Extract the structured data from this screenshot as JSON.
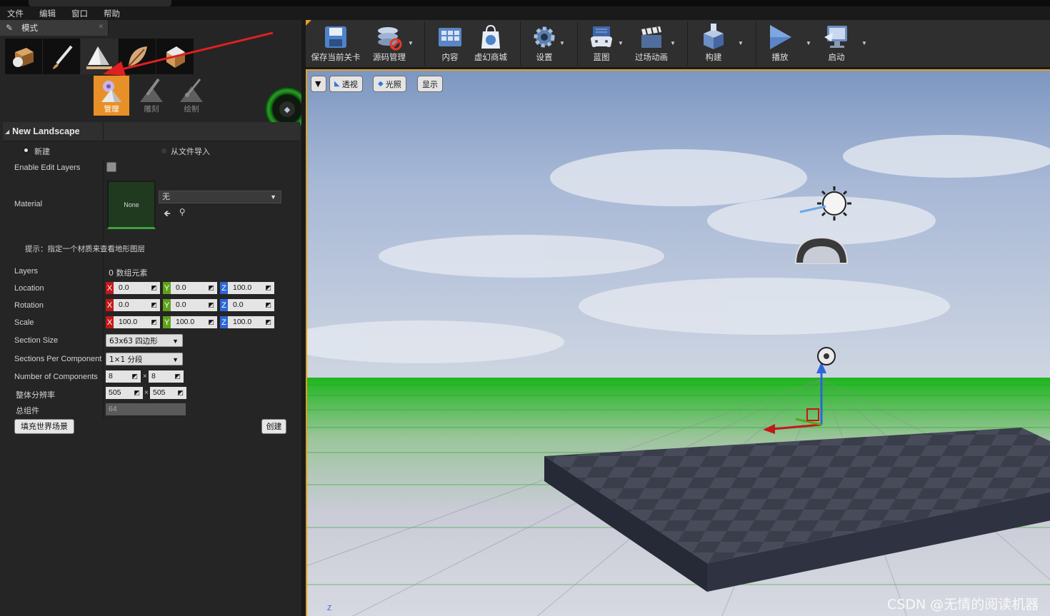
{
  "menubar": {
    "items": [
      "文件",
      "编辑",
      "窗口",
      "帮助"
    ]
  },
  "modes_tab": {
    "label": "模式",
    "icon": "modes-icon"
  },
  "mode_buttons": [
    {
      "name": "place-mode-icon"
    },
    {
      "name": "paint-mode-icon"
    },
    {
      "name": "landscape-mode-icon",
      "active": true
    },
    {
      "name": "foliage-mode-icon"
    },
    {
      "name": "geometry-mode-icon"
    }
  ],
  "landscape_tools": [
    {
      "label": "管理",
      "icon": "manage-icon",
      "active": true
    },
    {
      "label": "雕刻",
      "icon": "sculpt-icon"
    },
    {
      "label": "绘制",
      "icon": "paint-icon"
    }
  ],
  "section": {
    "title": "New Landscape"
  },
  "source": {
    "new_label": "新建",
    "import_label": "从文件导入",
    "selected": "new"
  },
  "props": {
    "enable_edit_layers_label": "Enable Edit Layers",
    "material_label": "Material",
    "material_thumb": "None",
    "material_value": "无",
    "hint": "提示：指定一个材质来查看地形图层",
    "layers_label": "Layers",
    "layers_value": "0 数组元素",
    "location_label": "Location",
    "location": {
      "x": "0.0",
      "y": "0.0",
      "z": "100.0"
    },
    "rotation_label": "Rotation",
    "rotation": {
      "x": "0.0",
      "y": "0.0",
      "z": "0.0"
    },
    "scale_label": "Scale",
    "scale": {
      "x": "100.0",
      "y": "100.0",
      "z": "100.0"
    },
    "axis_x": "X",
    "axis_y": "Y",
    "axis_z": "Z",
    "section_size_label": "Section Size",
    "section_size_value": "63x63 四边形",
    "sections_per_label": "Sections Per Component",
    "sections_per_value": "1×1 分段",
    "num_components_label": "Number of Components",
    "num_components": {
      "a": "8",
      "b": "8"
    },
    "resolution_label": "整体分辨率",
    "resolution": {
      "a": "505",
      "b": "505"
    },
    "times": "×",
    "total_label": "总组件",
    "total_value": "64",
    "fill_button": "填充世界场景",
    "create_button": "创建"
  },
  "toolbar": [
    {
      "label": "保存当前关卡",
      "icon": "save-icon"
    },
    {
      "label": "源码管理",
      "icon": "source-control-icon"
    },
    {
      "label": "内容",
      "icon": "content-icon"
    },
    {
      "label": "虚幻商城",
      "icon": "marketplace-icon"
    },
    {
      "label": "设置",
      "icon": "settings-icon"
    },
    {
      "label": "蓝图",
      "icon": "blueprint-icon"
    },
    {
      "label": "过场动画",
      "icon": "cinematics-icon"
    },
    {
      "label": "构建",
      "icon": "build-icon"
    },
    {
      "label": "播放",
      "icon": "play-icon"
    },
    {
      "label": "启动",
      "icon": "launch-icon"
    }
  ],
  "viewport": {
    "view_mode": "透视",
    "lighting": "光照",
    "show": "显示",
    "axis_indicator": "Z"
  },
  "watermark": "CSDN @无情的阅读机器",
  "colors": {
    "accent": "#E89028",
    "landscape_grid": "#22C022",
    "axis_x": "#C41818",
    "axis_y": "#5EA21A",
    "axis_z": "#2D66D6"
  }
}
